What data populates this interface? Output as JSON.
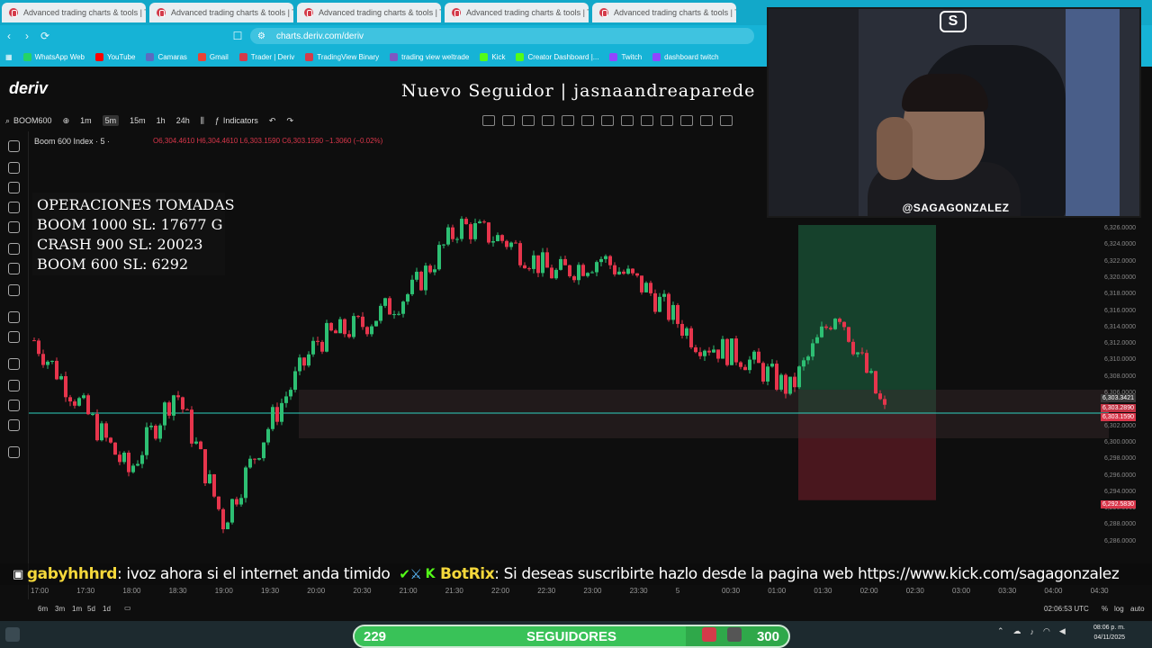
{
  "browser": {
    "tabs": [
      {
        "label": "Advanced trading charts & tools | Tr"
      },
      {
        "label": "Advanced trading charts & tools | Tr"
      },
      {
        "label": "Advanced trading charts & tools | Tr"
      },
      {
        "label": "Advanced trading charts & tools | Tr"
      },
      {
        "label": "Advanced trading charts & tools | Tr"
      }
    ],
    "url": "charts.deriv.com/deriv",
    "bookmarks": [
      {
        "label": "WhatsApp Web",
        "color": "#25d366"
      },
      {
        "label": "YouTube",
        "color": "#ff0000"
      },
      {
        "label": "Camaras",
        "color": "#5c6bc0"
      },
      {
        "label": "Gmail",
        "color": "#ea4335"
      },
      {
        "label": "Trader | Deriv",
        "color": "#d43b4a"
      },
      {
        "label": "TradingView Binary",
        "color": "#d43b4a"
      },
      {
        "label": "trading view weltrade",
        "color": "#7e57c2"
      },
      {
        "label": "Kick",
        "color": "#53fc18"
      },
      {
        "label": "Creator Dashboard |...",
        "color": "#53fc18"
      },
      {
        "label": "Twitch",
        "color": "#9146ff"
      },
      {
        "label": "dashboard twitch",
        "color": "#9146ff"
      }
    ]
  },
  "header": {
    "logo": "deriv",
    "follower_alert": "Nuevo Seguidor | jasnaandreaparede"
  },
  "toolbar": {
    "symbol": "BOOM600",
    "intervals": [
      "1m",
      "5m",
      "15m",
      "1h",
      "24h"
    ],
    "active_interval": "5m",
    "indicators": "Indicators"
  },
  "chart": {
    "legend": "Boom 600 Index · 5 ·",
    "ohlc": "O6,304.4610 H6,304.4610 L6,303.1590 C6,303.1590 −1.3060 (−0.02%)",
    "operations": {
      "title": "OPERACIONES TOMADAS",
      "lines": [
        "BOOM 1000 SL: 17677 G",
        "CRASH 900 SL: 20023",
        "BOOM 600 SL: 6292"
      ]
    },
    "price_labels": [
      "6,326.0000",
      "6,324.0000",
      "6,322.0000",
      "6,320.0000",
      "6,318.0000",
      "6,316.0000",
      "6,314.0000",
      "6,312.0000",
      "6,310.0000",
      "6,308.0000",
      "6,306.0000",
      "6,304.0000",
      "6,302.0000",
      "6,300.0000",
      "6,298.0000",
      "6,296.0000",
      "6,294.0000",
      "6,290.0000",
      "6,288.0000",
      "6,286.0000"
    ],
    "tag_current": "6,303.1590",
    "tag_mid": "6,303.2890",
    "tag_top": "6,303.3421",
    "tag_sl": "6,292.5830",
    "time_labels": [
      "17:00",
      "17:30",
      "18:00",
      "18:30",
      "19:00",
      "19:30",
      "20:00",
      "20:30",
      "21:00",
      "21:30",
      "22:00",
      "22:30",
      "23:00",
      "23:30",
      "5",
      "00:30",
      "01:00",
      "01:30",
      "02:00",
      "02:30",
      "03:00",
      "03:30",
      "04:00",
      "04:30"
    ],
    "clock": "02:06:53 UTC",
    "ranges": [
      "6m",
      "3m",
      "1m",
      "5d",
      "1d"
    ],
    "scale_opts": [
      "%",
      "log",
      "auto"
    ]
  },
  "chart_data": {
    "type": "candlestick",
    "ylim": [
      6286,
      6326
    ],
    "x": [
      "17:00",
      "17:30",
      "18:00",
      "18:30",
      "19:00",
      "19:30",
      "20:00",
      "20:30",
      "21:00",
      "21:30",
      "22:00",
      "22:30",
      "23:00",
      "23:30",
      "5",
      "00:30",
      "01:00",
      "01:30",
      "02:00"
    ],
    "close": [
      6312,
      6304,
      6296,
      6306,
      6290,
      6302,
      6312,
      6314,
      6318,
      6326,
      6324,
      6320,
      6322,
      6318,
      6312,
      6310,
      6306,
      6316,
      6303.159
    ],
    "stop_loss": 6292.583,
    "take_profit_zone": [
      6303.159,
      6326
    ]
  },
  "ticker": {
    "user1": "gabyhhhrd",
    "msg1": ": ivoz ahora si el internet anda timido",
    "user2": "BotRix",
    "msg2": ": Si deseas suscribirte hazlo desde la pagina web https://www.kick.com/sagagonzalez"
  },
  "webcam": {
    "handle": "@SAGAGONZALEZ",
    "logo": "S"
  },
  "followers": {
    "count": "229",
    "label": "SEGUIDORES",
    "goal": "300",
    "progress": 0.763
  },
  "taskbar": {
    "time": "08:06 p. m.",
    "date": "04/11/2025"
  }
}
